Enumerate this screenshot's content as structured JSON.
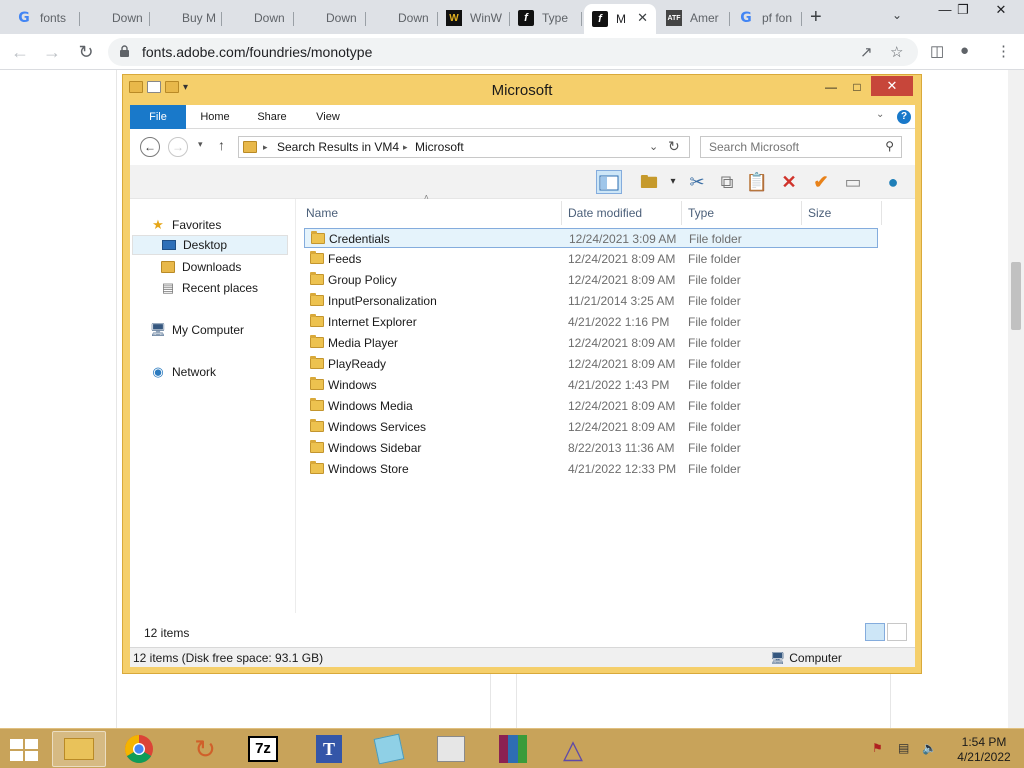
{
  "browser": {
    "tabs": [
      {
        "title": "fonts",
        "icon": "google-icon"
      },
      {
        "title": "Down",
        "icon": "microsoft-icon"
      },
      {
        "title": "Buy M",
        "icon": "microsoft-icon"
      },
      {
        "title": "Down",
        "icon": "microsoft-icon"
      },
      {
        "title": "Down",
        "icon": "microsoft-icon"
      },
      {
        "title": "Down",
        "icon": "microsoft-icon"
      },
      {
        "title": "WinW",
        "icon": "winworld-icon"
      },
      {
        "title": "Type",
        "icon": "fonts-icon"
      },
      {
        "title": "M",
        "icon": "fonts-icon",
        "active": true
      },
      {
        "title": "Amer",
        "icon": "atf-icon"
      },
      {
        "title": "pf fon",
        "icon": "google-icon"
      }
    ],
    "url": "fonts.adobe.com/foundries/monotype"
  },
  "explorer": {
    "title": "Microsoft",
    "ribbon_tabs": [
      "File",
      "Home",
      "Share",
      "View"
    ],
    "breadcrumb": [
      "Search Results in VM4",
      "Microsoft"
    ],
    "search_placeholder": "Search Microsoft",
    "nav": {
      "favorites": "Favorites",
      "desktop": "Desktop",
      "downloads": "Downloads",
      "recent": "Recent places",
      "computer": "My Computer",
      "network": "Network"
    },
    "columns": {
      "name": "Name",
      "date": "Date modified",
      "type": "Type",
      "size": "Size"
    },
    "files": [
      {
        "name": "Credentials",
        "date": "12/24/2021 3:09 AM",
        "type": "File folder",
        "selected": true
      },
      {
        "name": "Feeds",
        "date": "12/24/2021 8:09 AM",
        "type": "File folder"
      },
      {
        "name": "Group Policy",
        "date": "12/24/2021 8:09 AM",
        "type": "File folder"
      },
      {
        "name": "InputPersonalization",
        "date": "11/21/2014 3:25 AM",
        "type": "File folder"
      },
      {
        "name": "Internet Explorer",
        "date": "4/21/2022 1:16 PM",
        "type": "File folder"
      },
      {
        "name": "Media Player",
        "date": "12/24/2021 8:09 AM",
        "type": "File folder"
      },
      {
        "name": "PlayReady",
        "date": "12/24/2021 8:09 AM",
        "type": "File folder"
      },
      {
        "name": "Windows",
        "date": "4/21/2022 1:43 PM",
        "type": "File folder"
      },
      {
        "name": "Windows Media",
        "date": "12/24/2021 8:09 AM",
        "type": "File folder"
      },
      {
        "name": "Windows Services",
        "date": "12/24/2021 8:09 AM",
        "type": "File folder"
      },
      {
        "name": "Windows Sidebar",
        "date": "8/22/2013 11:36 AM",
        "type": "File folder"
      },
      {
        "name": "Windows Store",
        "date": "4/21/2022 12:33 PM",
        "type": "File folder"
      }
    ],
    "item_count": "12 items",
    "status_left": "12 items (Disk free space: 93.1 GB)",
    "status_right": "Computer"
  },
  "taskbar": {
    "time": "1:54 PM",
    "date": "4/21/2022",
    "seven_zip_label": "7z"
  },
  "colors": {
    "accent": "#1979ca",
    "window_frame": "#f5cf6b",
    "taskbar": "#c8a35a",
    "selection": "#e5f3fb"
  }
}
